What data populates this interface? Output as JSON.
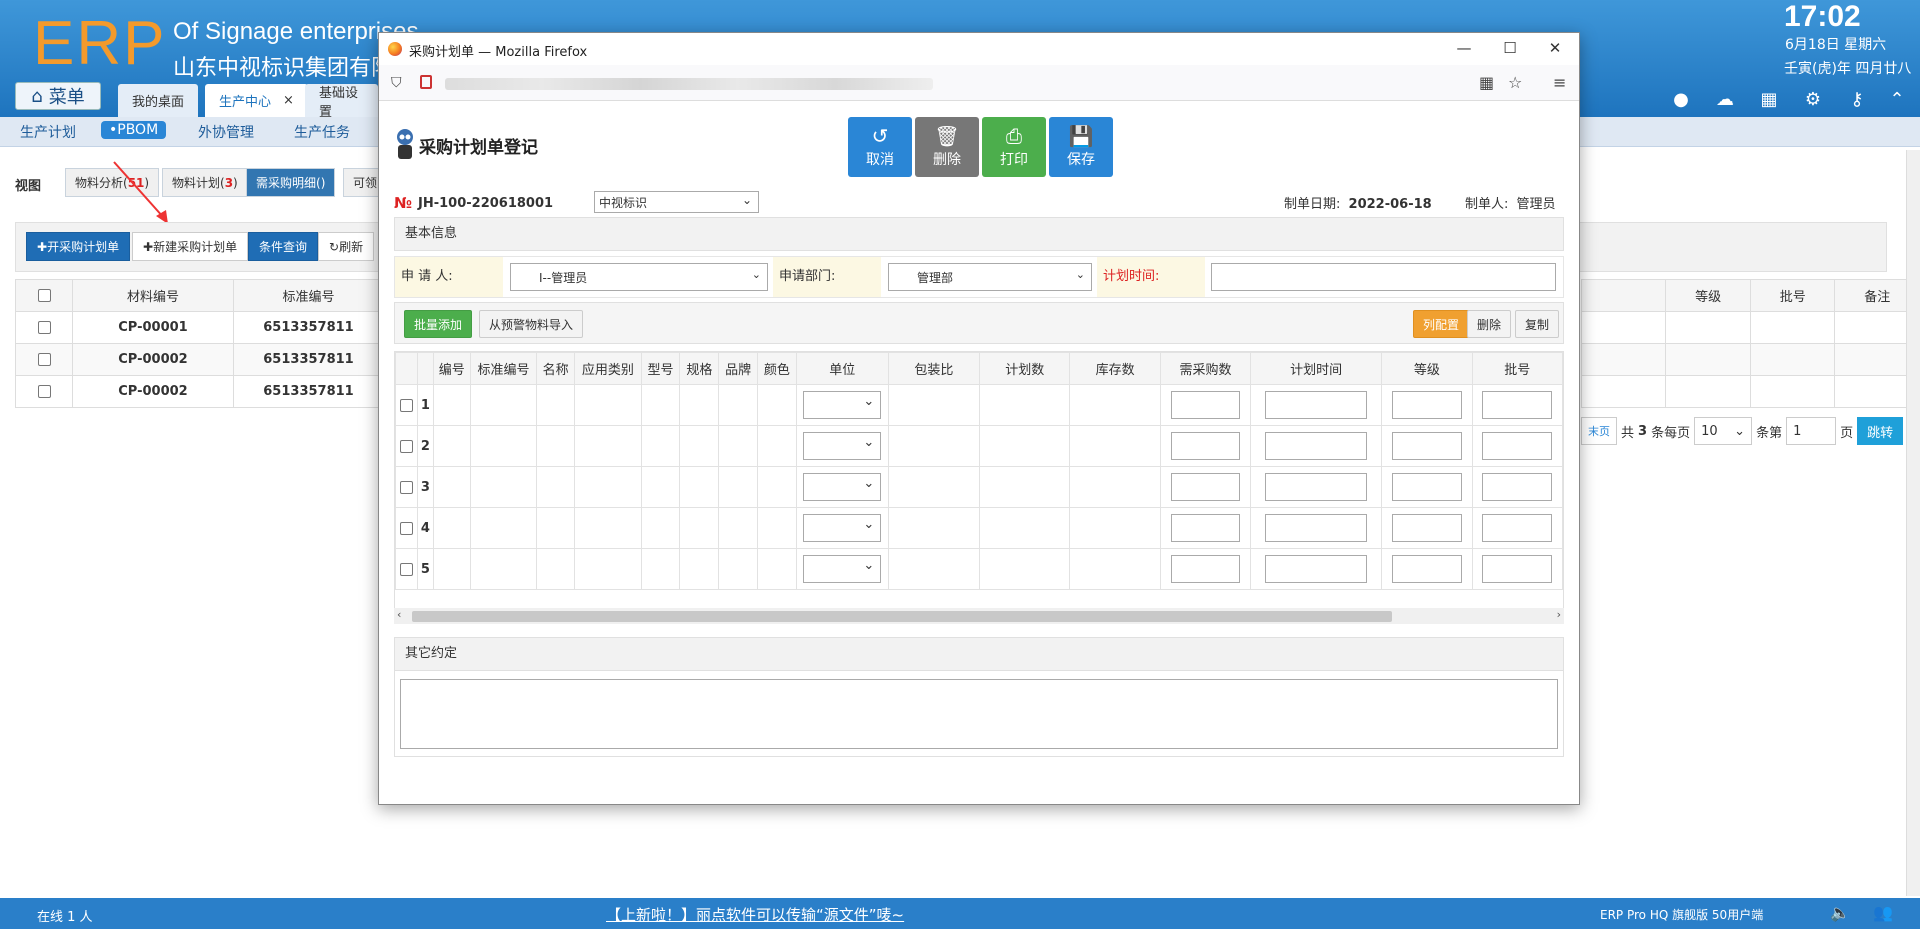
{
  "app": {
    "logo": "ERP",
    "company_en": "Of Signage enterprises",
    "company_cn": "山东中视标识集团有限公",
    "time": "17:02",
    "date": "6月18日 星期六",
    "lunar_date": "壬寅(虎)年 四月廿八",
    "menu_label": "菜单",
    "tabs": [
      {
        "label": "我的桌面"
      },
      {
        "label": "生产中心",
        "close": "×"
      },
      {
        "label": "基础设置"
      }
    ],
    "subnav": [
      "生产计划",
      "•PBOM",
      "外协管理",
      "生产任务"
    ],
    "view_label": "视图",
    "view_tabs": [
      {
        "label": "物料分析(",
        "count": "51",
        "suffix": ")"
      },
      {
        "label": "物料计划(",
        "count": "3",
        "suffix": ")"
      },
      {
        "label": "需采购明细(",
        "count": "",
        "suffix": ")"
      },
      {
        "label": "可领",
        "count": "",
        "suffix": ""
      }
    ],
    "toolbar": {
      "open_plan": "开采购计划单",
      "new_plan": "新建采购计划单",
      "query": "条件查询",
      "refresh": "刷新"
    },
    "table": {
      "headers": [
        "材料编号",
        "标准编号"
      ],
      "rows": [
        {
          "code": "CP-00001",
          "std": "6513357811"
        },
        {
          "code": "CP-00002",
          "std": "6513357811"
        },
        {
          "code": "CP-00002",
          "std": "6513357811"
        }
      ],
      "right_headers": [
        "等级",
        "批号",
        "备注"
      ]
    },
    "pager": {
      "last": "末页",
      "total_prefix": "共",
      "total": "3",
      "total_suffix": "条每页",
      "per_page": "10",
      "page_prefix": "条第",
      "page": "1",
      "page_suffix": "页",
      "go": "跳转"
    },
    "footer": {
      "online": "在线  1  人",
      "notice": "【上新啦！】丽点软件可以传输“源文件”唛~",
      "edition": "ERP Pro HQ 旗舰版 50用户端"
    }
  },
  "window": {
    "title": "采购计划单 — Mozilla Firefox",
    "controls": {
      "min": "—",
      "max": "☐",
      "close": "✕"
    }
  },
  "form": {
    "title": "采购计划单登记",
    "buttons": {
      "cancel": "取消",
      "delete": "删除",
      "print": "打印",
      "save": "保存"
    },
    "doc_symbol": "№",
    "doc_no": "JH-100-220618001",
    "org": "中视标识",
    "date_label": "制单日期:",
    "date_value": "2022-06-18",
    "maker_label": "制单人:",
    "maker_value": "管理员",
    "basic_info": "基本信息",
    "applicant_label": "申 请 人:",
    "applicant_value": "I--管理员",
    "dept_label": "申请部门:",
    "dept_value": "管理部",
    "plan_time_label": "计划时间:",
    "grid_buttons": {
      "batch_add": "批量添加",
      "import_warning": "从预警物料导入",
      "column_config": "列配置",
      "delete": "删除",
      "copy": "复制"
    },
    "grid_headers": [
      "编号",
      "标准编号",
      "名称",
      "应用类别",
      "型号",
      "规格",
      "品牌",
      "颜色",
      "单位",
      "包装比",
      "计划数",
      "库存数",
      "需采购数",
      "计划时间",
      "等级",
      "批号"
    ],
    "rows": [
      "1",
      "2",
      "3",
      "4",
      "5"
    ],
    "other_terms": "其它约定"
  },
  "colors": {
    "accent": "#1e74be",
    "cancel_btn": "#2a86d6",
    "delete_btn": "#777777",
    "print_btn": "#4cae4c",
    "save_btn": "#2a86d6",
    "batch_add": "#4cae4c",
    "column_config": "#f0a030"
  }
}
